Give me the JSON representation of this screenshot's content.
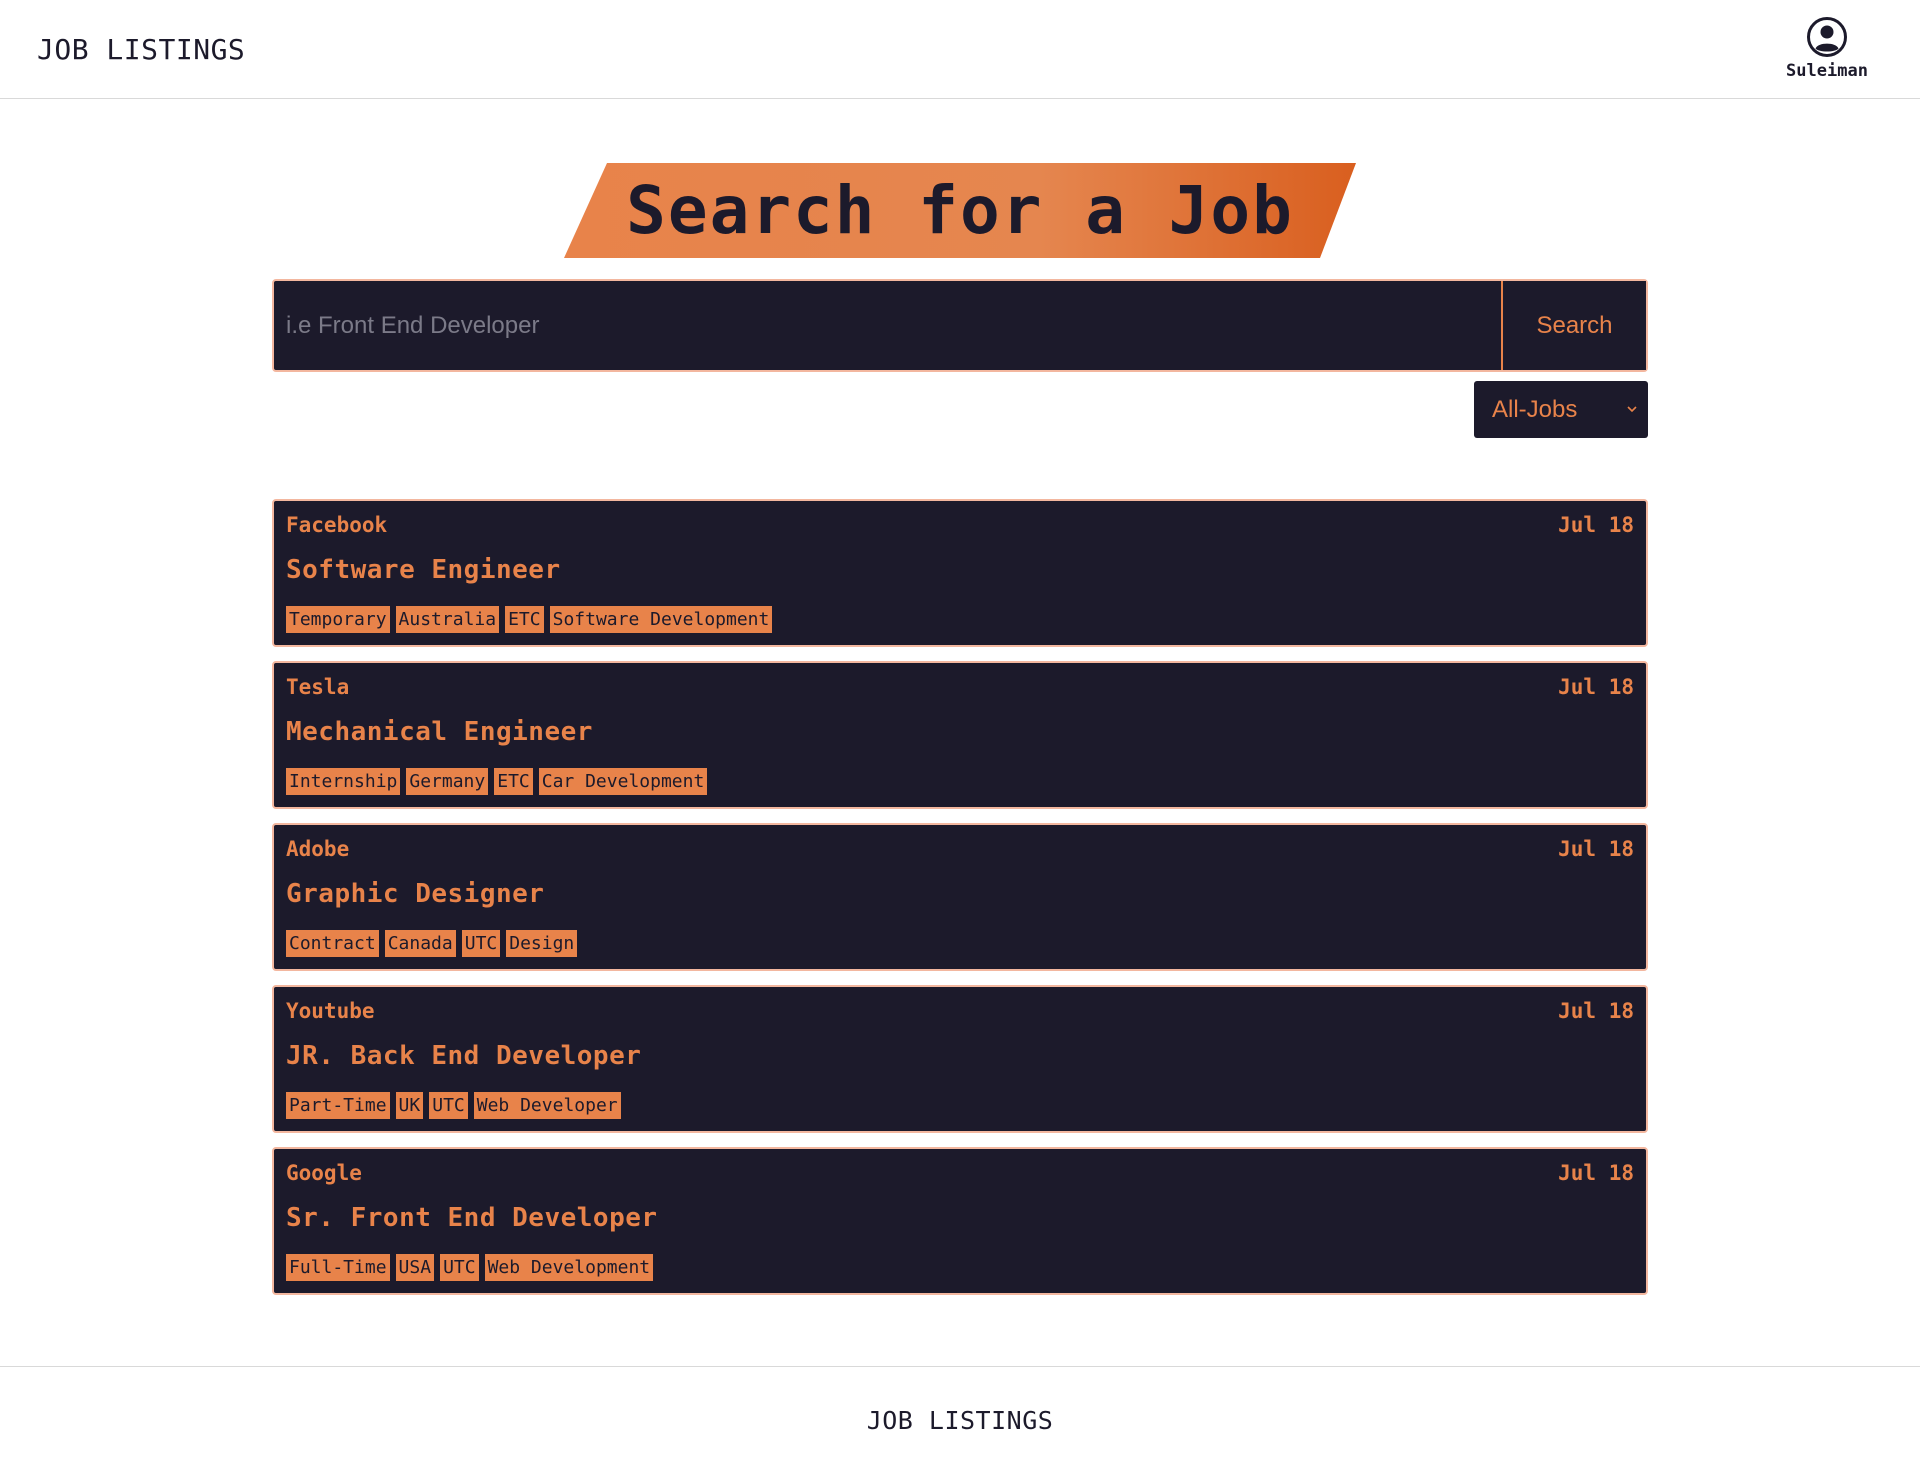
{
  "header": {
    "brand": "JOB LISTINGS",
    "user_name": "Suleiman",
    "user_icon": "user-circle-icon"
  },
  "hero": {
    "title": "Search for a Job"
  },
  "search": {
    "placeholder": "i.e Front End Developer",
    "value": "",
    "button_label": "Search"
  },
  "filter": {
    "selected": "All-Jobs",
    "icon": "chevron-down-icon"
  },
  "jobs": [
    {
      "company": "Facebook",
      "date": "Jul 18",
      "title": "Software Engineer",
      "tags": [
        "Temporary",
        "Australia",
        "ETC",
        "Software Development"
      ]
    },
    {
      "company": "Tesla",
      "date": "Jul 18",
      "title": "Mechanical Engineer",
      "tags": [
        "Internship",
        "Germany",
        "ETC",
        "Car Development"
      ]
    },
    {
      "company": "Adobe",
      "date": "Jul 18",
      "title": "Graphic Designer",
      "tags": [
        "Contract",
        "Canada",
        "UTC",
        "Design"
      ]
    },
    {
      "company": "Youtube",
      "date": "Jul 18",
      "title": "JR. Back End Developer",
      "tags": [
        "Part-Time",
        "UK",
        "UTC",
        "Web Developer"
      ]
    },
    {
      "company": "Google",
      "date": "Jul 18",
      "title": "Sr. Front End Developer",
      "tags": [
        "Full-Time",
        "USA",
        "UTC",
        "Web Development"
      ]
    }
  ],
  "footer": {
    "brand": "JOB LISTINGS"
  },
  "colors": {
    "accent": "#e8834a",
    "dark": "#1c1a2b",
    "border": "#f3b79f"
  }
}
